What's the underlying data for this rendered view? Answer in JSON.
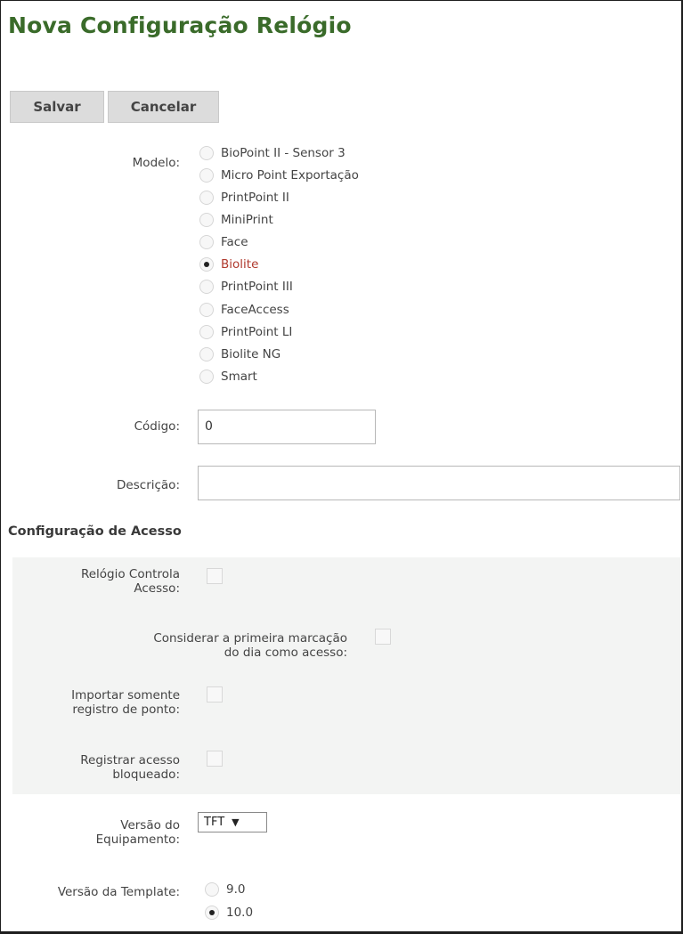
{
  "page": {
    "title": "Nova Configuração Relógio"
  },
  "toolbar": {
    "save_label": "Salvar",
    "cancel_label": "Cancelar"
  },
  "modelo": {
    "label": "Modelo:",
    "selected": "Biolite",
    "options": [
      "BioPoint II - Sensor 3",
      "Micro Point Exportação",
      "PrintPoint II",
      "MiniPrint",
      "Face",
      "Biolite",
      "PrintPoint III",
      "FaceAccess",
      "PrintPoint LI",
      "Biolite NG",
      "Smart"
    ]
  },
  "codigo": {
    "label": "Código:",
    "value": "0"
  },
  "descricao": {
    "label": "Descrição:",
    "value": ""
  },
  "acesso": {
    "section_title": "Configuração de Acesso",
    "relogio_controla": {
      "label_line1": "Relógio Controla",
      "label_line2": "Acesso:",
      "checked": false
    },
    "primeira_marcacao": {
      "label_line1": "Considerar a primeira marcação",
      "label_line2": "do dia como acesso:",
      "checked": false
    },
    "importar_somente": {
      "label_line1": "Importar somente",
      "label_line2": "registro de ponto:",
      "checked": false
    },
    "registrar_bloqueado": {
      "label_line1": "Registrar acesso",
      "label_line2": "bloqueado:",
      "checked": false
    }
  },
  "versao_equipamento": {
    "label_line1": "Versão do",
    "label_line2": "Equipamento:",
    "value": "TFT"
  },
  "versao_template": {
    "label": "Versão da Template:",
    "selected": "10.0",
    "options": [
      "9.0",
      "10.0"
    ]
  }
}
